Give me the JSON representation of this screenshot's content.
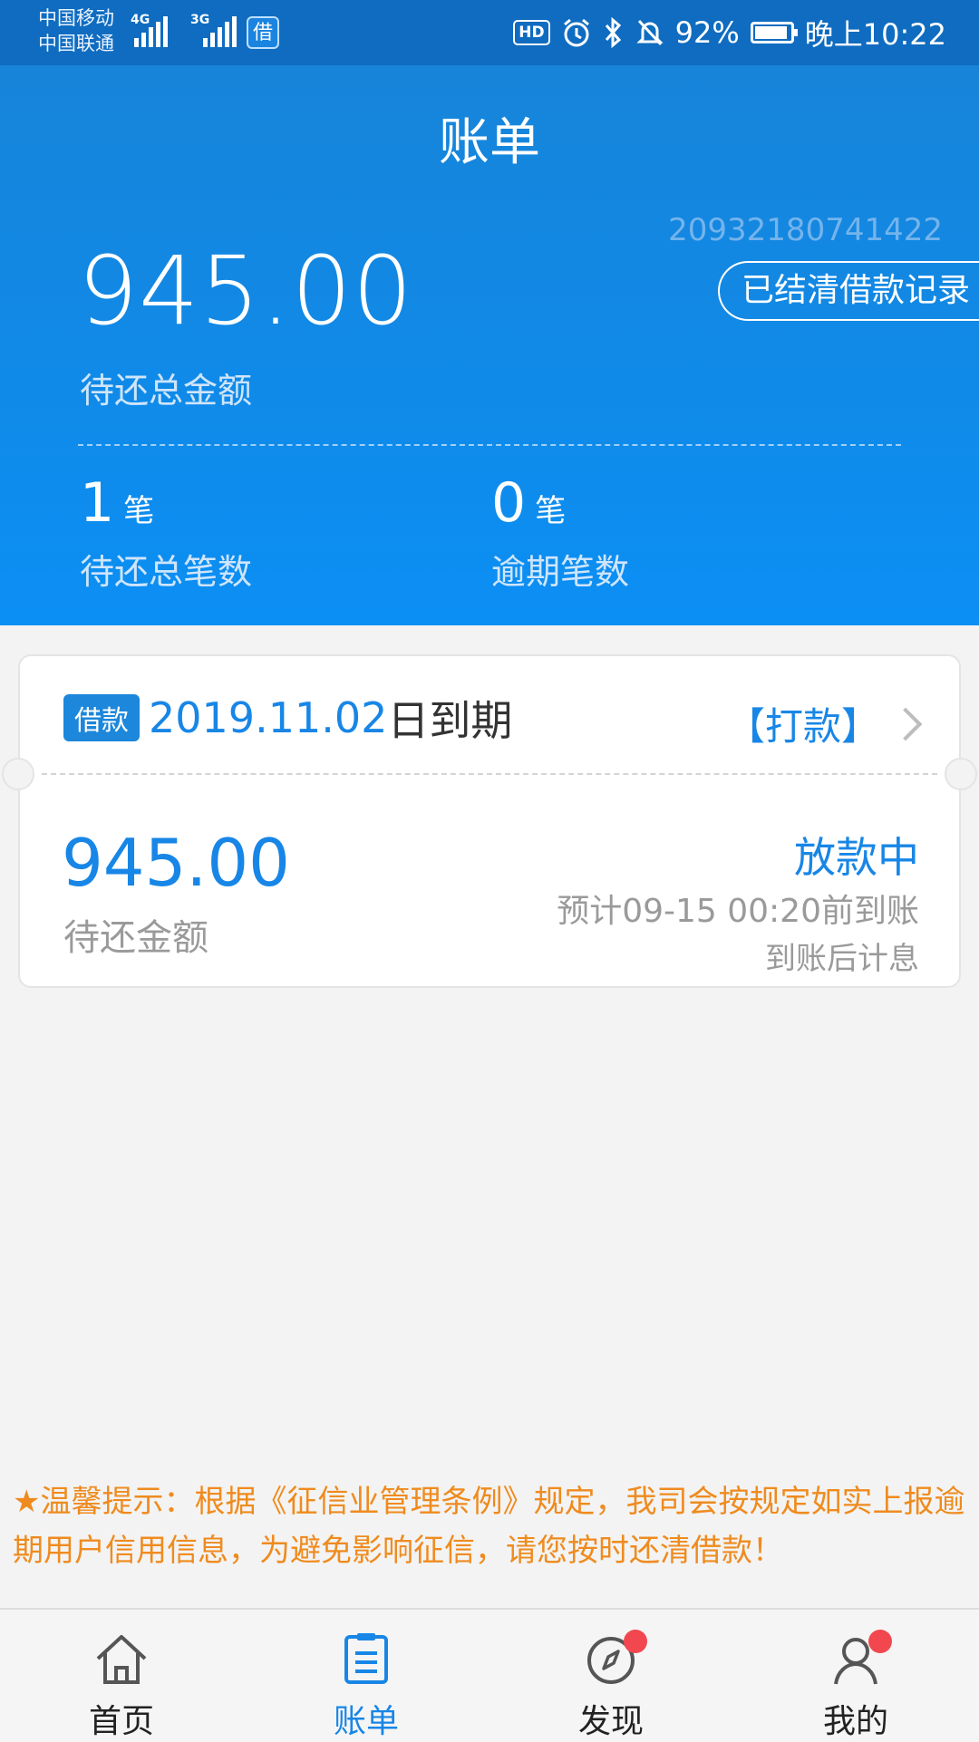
{
  "status_bar": {
    "carrier1": "中国移动",
    "carrier2": "中国联通",
    "net1": "4G",
    "net2": "3G",
    "app_badge": "借",
    "hd": "HD",
    "battery": "92%",
    "battery_level": 0.92,
    "time": "晚上10:22"
  },
  "header": {
    "title": "账单",
    "serial": "20932180741422",
    "settled_button": "已结清借款记录",
    "total_amount": "945.00",
    "total_label": "待还总金额",
    "pending_count": "1",
    "pending_unit": "笔",
    "pending_label": "待还总笔数",
    "overdue_count": "0",
    "overdue_unit": "笔",
    "overdue_label": "逾期笔数"
  },
  "loan_card": {
    "tag": "借款",
    "due_date": "2019.11.02",
    "due_suffix": "日到期",
    "pay_link": "【打款】",
    "amount": "945.00",
    "amount_label": "待还金额",
    "status": "放款中",
    "eta": "预计09-15 00:20前到账",
    "interest_note": "到账后计息"
  },
  "notice": "★温馨提示：根据《征信业管理条例》规定，我司会按规定如实上报逾期用户信用信息，为避免影响征信，请您按时还清借款！",
  "tabbar": {
    "home": "首页",
    "bills": "账单",
    "discover": "发现",
    "mine": "我的"
  },
  "colors": {
    "primary": "#1886e6",
    "header_top": "#1784d9",
    "notice": "#ef8b1e",
    "badge_dot": "#f2474f"
  }
}
